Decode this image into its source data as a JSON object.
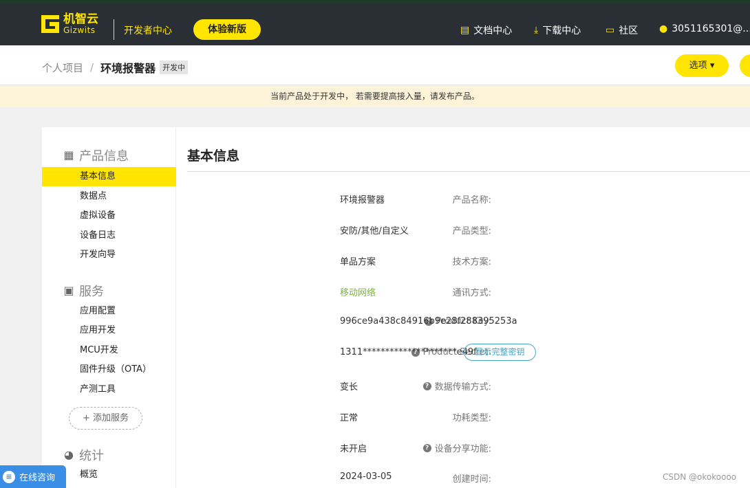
{
  "header": {
    "logo_cn": "机智云",
    "logo_en": "Gizwits",
    "dev_center": "开发者中心",
    "try_new": "体验新版",
    "docs": "文档中心",
    "downloads": "下载中心",
    "community": "社区",
    "user": "3051165301@..."
  },
  "breadcrumb": {
    "parent": "个人项目",
    "separator": "/",
    "current": "环境报警器",
    "status_tag": "开发中"
  },
  "options_button": "选项",
  "notice": "当前产品处于开发中， 若需要提高接入量，请发布产品。",
  "sidebar": {
    "sections": [
      {
        "title": "产品信息",
        "items": [
          "基本信息",
          "数据点",
          "虚拟设备",
          "设备日志",
          "开发向导"
        ]
      },
      {
        "title": "服务",
        "items": [
          "应用配置",
          "应用开发",
          "MCU开发",
          "固件升级（OTA）",
          "产测工具"
        ]
      },
      {
        "title": "统计",
        "items": [
          "概览"
        ]
      }
    ],
    "add_service": "+ 添加服务"
  },
  "main": {
    "title": "基本信息",
    "fields": [
      {
        "label": "产品名称:",
        "value": "环境报警器"
      },
      {
        "label": "产品类型:",
        "value": "安防/其他/自定义"
      },
      {
        "label": "技术方案:",
        "value": "单品方案"
      },
      {
        "label": "通讯方式:",
        "value": "移动网络"
      },
      {
        "label": "Product Key:",
        "value": "996ce9a438c84916b9e28f288395253a"
      },
      {
        "label": "Product Secret:",
        "value": "1311*********************e49f"
      },
      {
        "label": "数据传输方式:",
        "value": "变长"
      },
      {
        "label": "功耗类型:",
        "value": "正常"
      },
      {
        "label": "设备分享功能:",
        "value": "未开启"
      },
      {
        "label": "创建时间:",
        "value": "2024-03-05"
      }
    ],
    "show_secret": "显示完整密钥"
  },
  "chat": "在线咨询",
  "watermark": "CSDN @okokoooo",
  "colors": {
    "brand_yellow": "#ffe500",
    "topbar": "#2a2f36",
    "link_green": "#7cb342",
    "chat_blue": "#3a8ee6"
  }
}
